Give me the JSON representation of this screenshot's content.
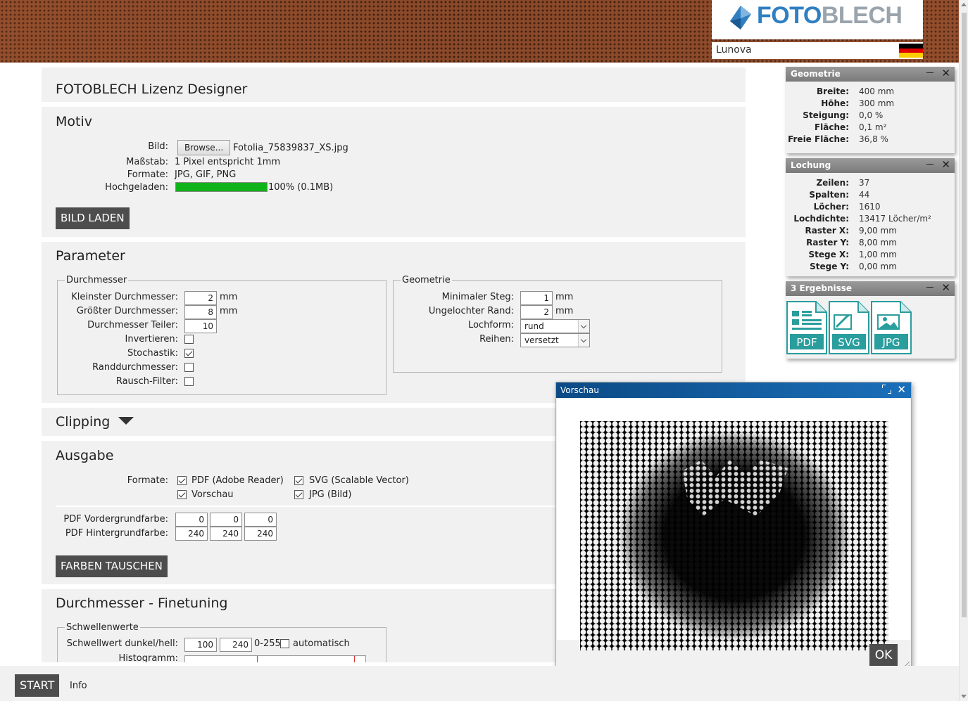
{
  "header": {
    "logo_text_a": "FOTO",
    "logo_text_b": "BLECH",
    "user": "Lunova",
    "flag_colors": [
      "#000000",
      "#dd0000",
      "#ffce00"
    ]
  },
  "page_title": "FOTOBLECH Lizenz Designer",
  "motiv": {
    "title": "Motiv",
    "bild_label": "Bild:",
    "browse_label": "Browse...",
    "file_name": "Fotolia_75839837_XS.jpg",
    "massstab_label": "Maßstab:",
    "massstab_value": "1 Pixel entspricht 1mm",
    "formate_label": "Formate:",
    "formate_value": "JPG, GIF, PNG",
    "hochgeladen_label": "Hochgeladen:",
    "upload_progress": 1.0,
    "upload_text": "100% (0.1MB)",
    "button": "BILD LADEN"
  },
  "parameter": {
    "title": "Parameter",
    "durchmesser": {
      "legend": "Durchmesser",
      "kleinster_label": "Kleinster Durchmesser:",
      "kleinster_value": "2",
      "groesster_label": "Größter Durchmesser:",
      "groesster_value": "8",
      "unit": "mm",
      "teiler_label": "Durchmesser Teiler:",
      "teiler_value": "10",
      "invertieren_label": "Invertieren:",
      "invertieren": false,
      "stochastik_label": "Stochastik:",
      "stochastik": true,
      "randdurchmesser_label": "Randdurchmesser:",
      "randdurchmesser": false,
      "rausch_label": "Rausch-Filter:",
      "rausch": false
    },
    "geometrie": {
      "legend": "Geometrie",
      "steg_label": "Minimaler Steg:",
      "steg_value": "1",
      "rand_label": "Ungelochter Rand:",
      "rand_value": "2",
      "unit": "mm",
      "lochform_label": "Lochform:",
      "lochform_value": "rund",
      "reihen_label": "Reihen:",
      "reihen_value": "versetzt"
    }
  },
  "clipping": {
    "title": "Clipping"
  },
  "ausgabe": {
    "title": "Ausgabe",
    "formate_label": "Formate:",
    "pdf_label": "PDF (Adobe Reader)",
    "svg_label": "SVG (Scalable Vector)",
    "vorschau_label": "Vorschau",
    "jpg_label": "JPG (Bild)",
    "vordergrund_label": "PDF Vordergrundfarbe:",
    "vordergrund": [
      "0",
      "0",
      "0"
    ],
    "hintergrund_label": "PDF Hintergrundfarbe:",
    "hintergrund": [
      "240",
      "240",
      "240"
    ],
    "button": "FARBEN TAUSCHEN"
  },
  "finetuning": {
    "title": "Durchmesser - Finetuning",
    "legend": "Schwellenwerte",
    "schwellwert_label": "Schwellwert dunkel/hell:",
    "dunkel": "100",
    "hell": "240",
    "range": "0-255",
    "automatisch_label": "automatisch",
    "histogramm_label": "Histogramm:"
  },
  "widget_geometrie": {
    "title": "Geometrie",
    "rows": [
      {
        "k": "Breite:",
        "v": "400 mm"
      },
      {
        "k": "Höhe:",
        "v": "300 mm"
      },
      {
        "k": "Steigung:",
        "v": "0,0 %"
      },
      {
        "k": "Fläche:",
        "v": "0,1 m²"
      },
      {
        "k": "Freie Fläche:",
        "v": "36,8 %"
      }
    ]
  },
  "widget_lochung": {
    "title": "Lochung",
    "rows": [
      {
        "k": "Zeilen:",
        "v": "37"
      },
      {
        "k": "Spalten:",
        "v": "44"
      },
      {
        "k": "Löcher:",
        "v": "1610"
      },
      {
        "k": "Lochdichte:",
        "v": "13417 Löcher/m²"
      },
      {
        "k": "Raster X:",
        "v": "9,00 mm"
      },
      {
        "k": "Raster Y:",
        "v": "8,00 mm"
      },
      {
        "k": "Stege X:",
        "v": "1,00 mm"
      },
      {
        "k": "Stege Y:",
        "v": "0,00 mm"
      }
    ]
  },
  "widget_ergebnisse": {
    "title": "3 Ergebnisse",
    "files": [
      {
        "label": "PDF",
        "icon": "pdf-document-icon"
      },
      {
        "label": "SVG",
        "icon": "svg-document-icon"
      },
      {
        "label": "JPG",
        "icon": "jpg-image-icon"
      }
    ]
  },
  "preview": {
    "title": "Vorschau",
    "ok": "OK"
  },
  "bottom": {
    "start": "START",
    "info": "Info"
  },
  "colors": {
    "accent_teal": "#2a9d9d",
    "dialog_header": "#0b4a85",
    "progress_green": "#11b31a",
    "dark_button": "#4d4d4d"
  }
}
